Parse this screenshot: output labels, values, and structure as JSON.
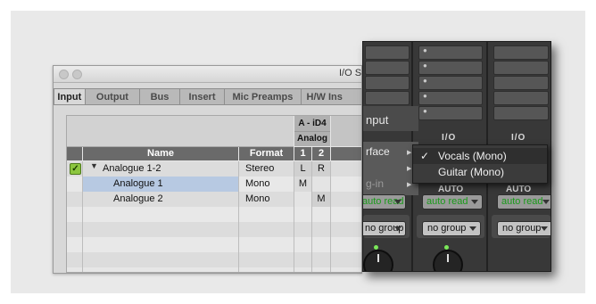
{
  "io_setup": {
    "title": "I/O S",
    "tabs": [
      {
        "label": "Input"
      },
      {
        "label": "Output"
      },
      {
        "label": "Bus"
      },
      {
        "label": "Insert"
      },
      {
        "label": "Mic Preamps"
      },
      {
        "label": "H/W Ins"
      }
    ],
    "active_tab": "Input",
    "device_header": "A - iD4",
    "analog_header": "Analog",
    "columns": {
      "name": "Name",
      "format": "Format",
      "ch1": "1",
      "ch2": "2"
    },
    "rows": [
      {
        "checked": true,
        "expanded": true,
        "name": "Analogue 1-2",
        "format": "Stereo",
        "ch1": "L",
        "ch2": "R"
      },
      {
        "checked": false,
        "name": "Analogue 1",
        "format": "Mono",
        "ch1": "M",
        "ch2": "",
        "selected": true
      },
      {
        "checked": false,
        "name": "Analogue 2",
        "format": "Mono",
        "ch1": "",
        "ch2": "M"
      }
    ],
    "check_glyph": "✓",
    "expand_glyph": "▼"
  },
  "mixer": {
    "menu_title": "nput",
    "menu_items": [
      {
        "label": "rface"
      },
      {
        "label": ""
      },
      {
        "label": "g-in"
      }
    ],
    "io_label": "I/O",
    "auto_label": "AUTO",
    "strips": [
      {
        "automation": "auto read",
        "group": "no group"
      },
      {
        "automation": "auto read",
        "group": "no group"
      },
      {
        "automation": "auto read",
        "group": "no group"
      }
    ],
    "submenu": [
      {
        "label": "Vocals (Mono)",
        "checked": true
      },
      {
        "label": "Guitar (Mono)",
        "checked": false
      }
    ],
    "check_glyph": "✓",
    "automation_color": "#1a9a1a"
  }
}
